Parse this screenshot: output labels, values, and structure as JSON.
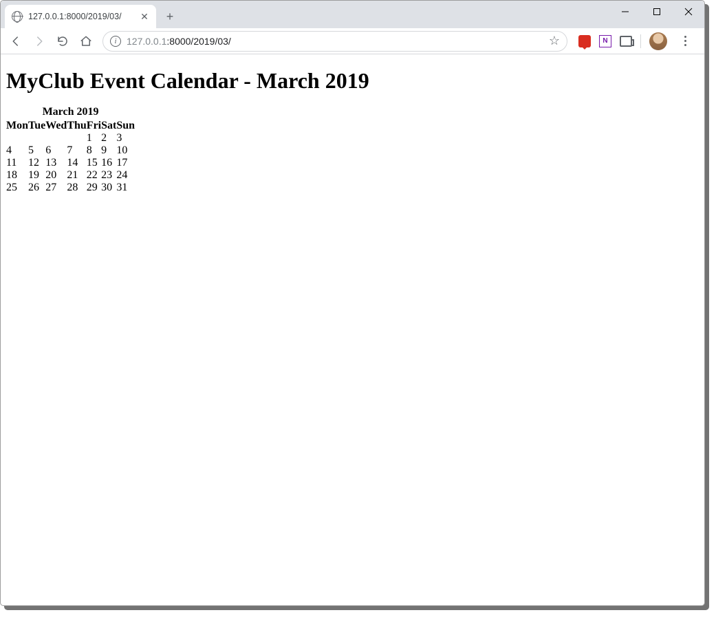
{
  "browser": {
    "tab_title": "127.0.0.1:8000/2019/03/",
    "url_dim_prefix": "127.0.0.1",
    "url_rest": ":8000/2019/03/"
  },
  "page": {
    "heading": "MyClub Event Calendar - March 2019"
  },
  "calendar": {
    "caption": "March 2019",
    "weekdays": [
      "Mon",
      "Tue",
      "Wed",
      "Thu",
      "Fri",
      "Sat",
      "Sun"
    ],
    "weeks": [
      [
        "",
        "",
        "",
        "",
        "1",
        "2",
        "3"
      ],
      [
        "4",
        "5",
        "6",
        "7",
        "8",
        "9",
        "10"
      ],
      [
        "11",
        "12",
        "13",
        "14",
        "15",
        "16",
        "17"
      ],
      [
        "18",
        "19",
        "20",
        "21",
        "22",
        "23",
        "24"
      ],
      [
        "25",
        "26",
        "27",
        "28",
        "29",
        "30",
        "31"
      ]
    ]
  }
}
